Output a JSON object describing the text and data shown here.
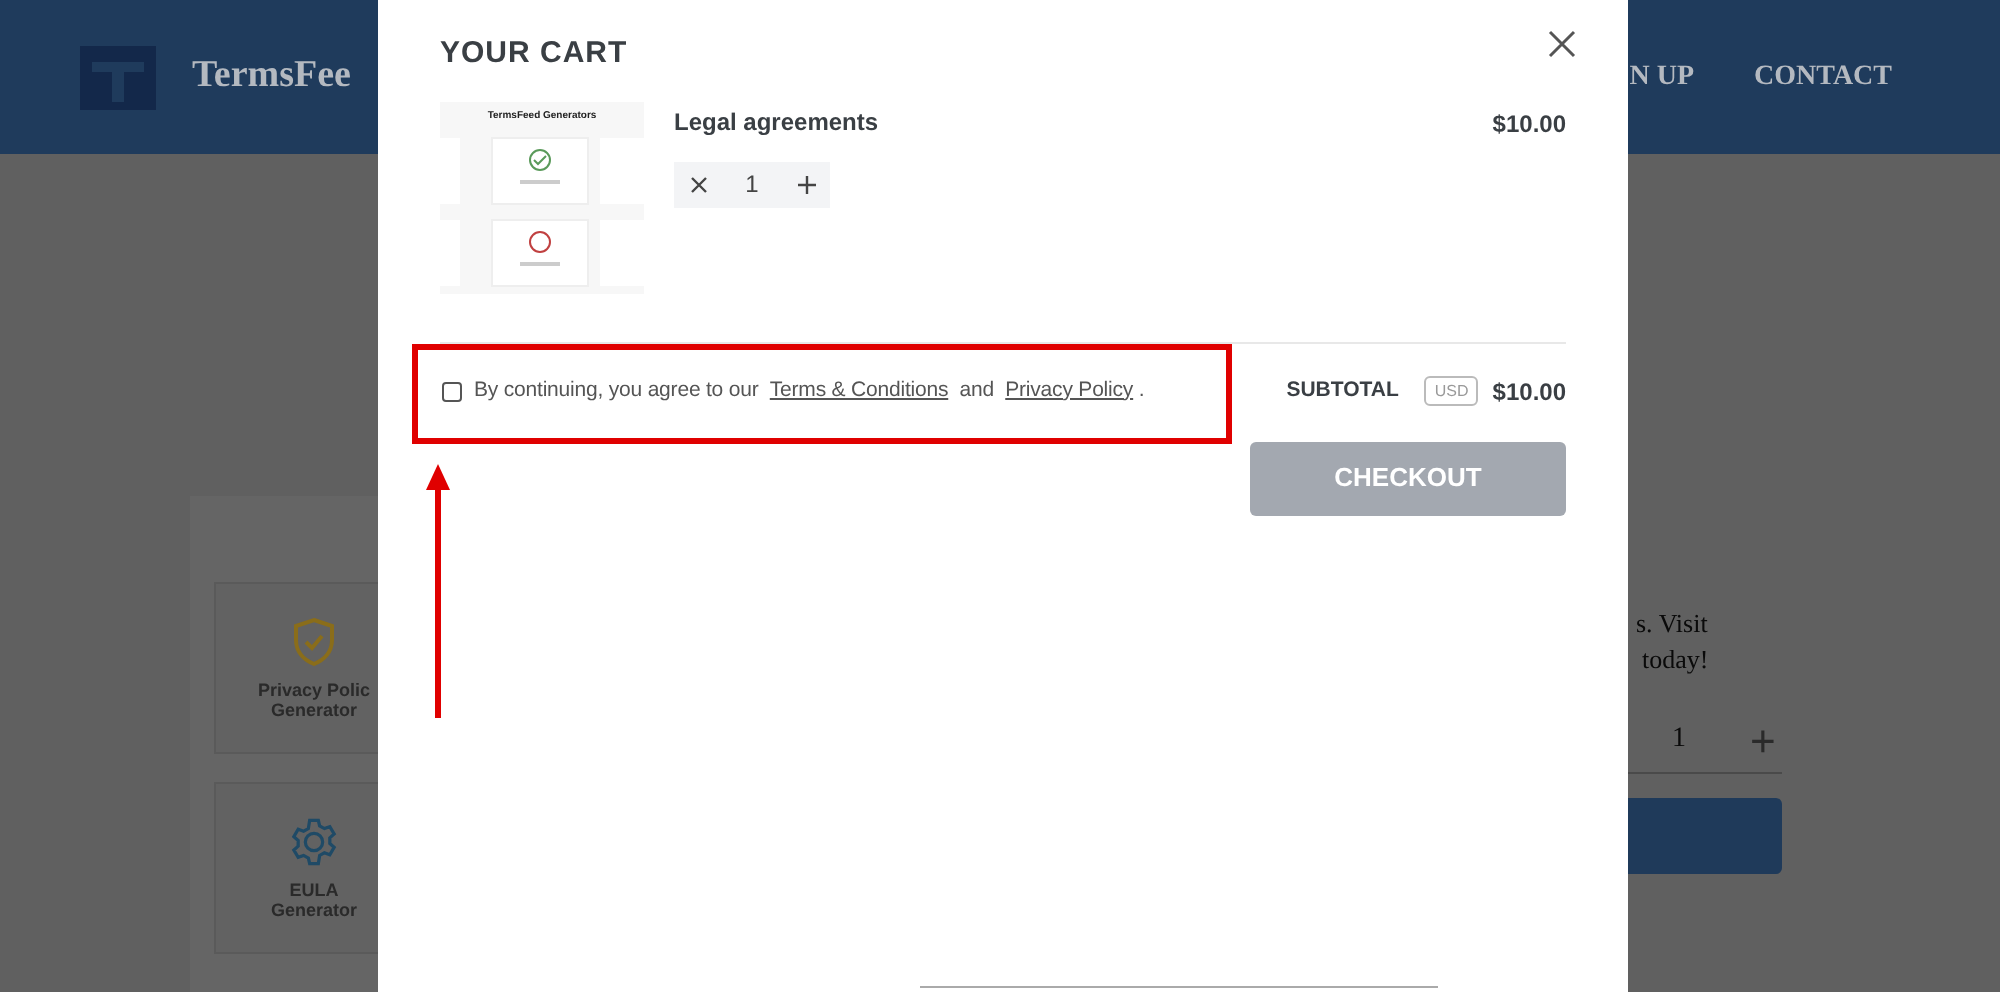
{
  "background_page": {
    "header": {
      "logo_text": "TermsFee",
      "nav": [
        "N UP",
        "CONTACT"
      ]
    },
    "cards": [
      {
        "label": "Privacy Polic",
        "sublabel": "Generator",
        "kind": "shield"
      },
      {
        "label": "EULA",
        "sublabel": "Generator",
        "kind": "gear"
      }
    ],
    "promo_lines": [
      "s. Visit",
      "today!"
    ],
    "quantity": {
      "value": "1",
      "plus": "+"
    }
  },
  "cart": {
    "title": "YOUR CART",
    "items": [
      {
        "thumbnail_title": "TermsFeed Generators",
        "name": "Legal agreements",
        "price": "$10.00",
        "quantity": "1"
      }
    ],
    "agreement": {
      "checked": false,
      "parts": [
        "By continuing, you agree to our",
        "and",
        "."
      ],
      "links": [
        "Terms & Conditions",
        "Privacy Policy"
      ]
    },
    "subtotal": {
      "label": "SUBTOTAL",
      "currency": "USD",
      "amount": "$10.00"
    },
    "checkout": {
      "label": "CHECKOUT",
      "disabled": true
    }
  },
  "annotation": {
    "box": true,
    "arrow": true
  }
}
